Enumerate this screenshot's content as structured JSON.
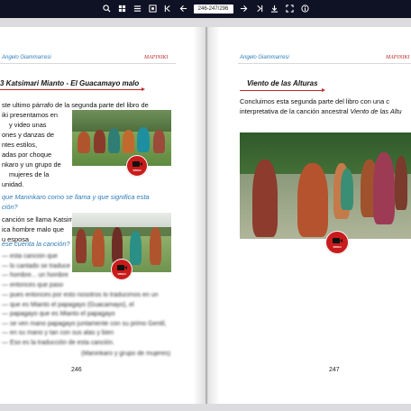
{
  "toolbar": {
    "page_indicator": "246-247/296",
    "icons": [
      "zoom-in-icon",
      "grid-icon",
      "list-icon",
      "fit-icon",
      "first-page-icon",
      "prev-page-icon",
      "next-page-icon",
      "last-page-icon",
      "download-icon",
      "fullscreen-icon",
      "info-icon"
    ]
  },
  "left_page": {
    "author": "Angelo Giammarresi",
    "mark": "MAPINIKI",
    "section_title": "3 Katsimari Mianto - El Guacamayo malo",
    "para1_lines": [
      "ste ultimo párrafo de la segunda parte del libro de",
      "iki presentamos en",
      "y video unas",
      "ones y danzas de",
      "ntes estilos,",
      "adas por choque",
      "nkaro y un grupo de",
      "mujeres de la",
      "unidad."
    ],
    "question1_lines": [
      "que Maninkaro como se llama y que significa esta",
      "ción?"
    ],
    "answer1_lines": [
      "canción se llama Katsimari Mianto",
      "ica hombre malo que",
      "u esposa"
    ],
    "question2": "ese cuenta la canción?",
    "blurred_lines": [
      "— esta canción que",
      "— lo cantado se traduce",
      "— hombre... un hombre",
      "— entonces que paso",
      "— pues entonces por esto nosotros lo traducimos en un",
      "— que es Mianto el papagayo (Guacamayo), el",
      "— papagayo que es Mianto el papagayo",
      "— se ven mano papagayo juntamente con su primo Gentil,",
      "— en su mano y tan con sus alas y bien",
      "— Eso es la traducción de esta canción."
    ],
    "blurred_signature": "(Maninkaro y grupo de mujeres)",
    "video_label_1": "VIDEO",
    "video_label_2": "VIDEO",
    "page_number": "246"
  },
  "right_page": {
    "author": "Angelo Giammarresi",
    "mark": "MAPINIKI",
    "section_title": "Viento de las Alturas",
    "para_line1": "Concluimos esta segunda parte del libro con una c",
    "para_line2_prefix": "interpretativa de la canción ancestral ",
    "para_line2_italic": "Viento de las Altu",
    "video_label": "VIDEO",
    "page_number": "247"
  },
  "colors": {
    "toolbar_bg": "#0f1124",
    "accent_blue": "#2e7bb8",
    "accent_red": "#c0292b",
    "video_badge": "#c91b1b"
  }
}
